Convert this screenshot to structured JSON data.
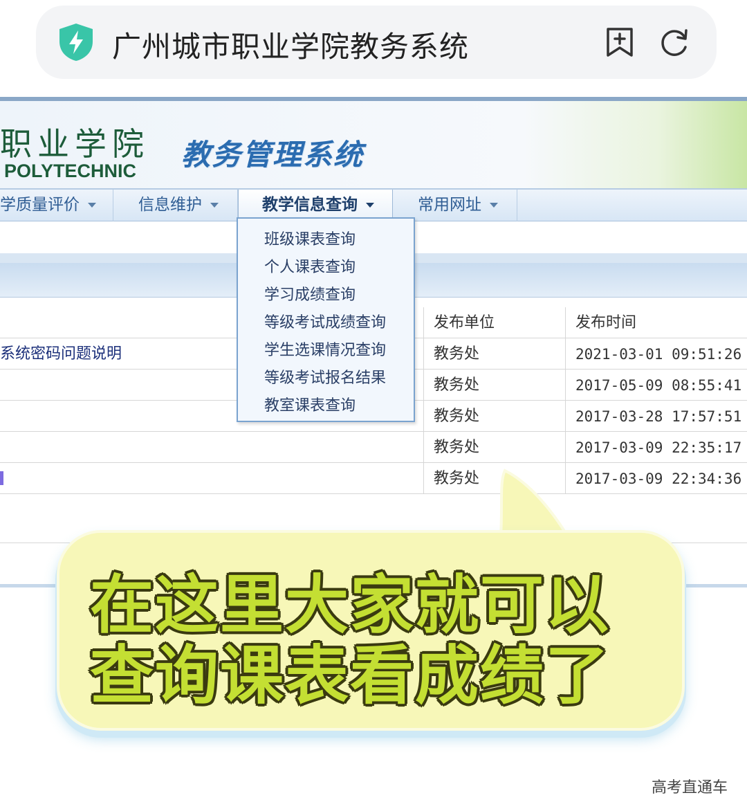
{
  "browser": {
    "site_title": "广州城市职业学院教务系统",
    "shield_color": "#39c5a8"
  },
  "header": {
    "school_cn": "职业学院",
    "school_en": "POLYTECHNIC",
    "system_title": "教务管理系统"
  },
  "nav": {
    "items": [
      {
        "label": "学质量评价"
      },
      {
        "label": "信息维护"
      },
      {
        "label": "教学信息查询"
      },
      {
        "label": "常用网址"
      }
    ]
  },
  "dropdown": {
    "items": [
      {
        "label": "班级课表查询"
      },
      {
        "label": "个人课表查询"
      },
      {
        "label": "学习成绩查询"
      },
      {
        "label": "等级考试成绩查询"
      },
      {
        "label": "学生选课情况查询"
      },
      {
        "label": "等级考试报名结果"
      },
      {
        "label": "教室课表查询"
      }
    ]
  },
  "table": {
    "headers": {
      "unit": "发布单位",
      "time": "发布时间"
    },
    "rows": [
      {
        "title": "系统密码问题说明",
        "unit": "教务处",
        "time": "2021-03-01 09:51:26"
      },
      {
        "title": "",
        "unit": "教务处",
        "time": "2017-05-09 08:55:41"
      },
      {
        "title": "",
        "unit": "教务处",
        "time": "2017-03-28 17:57:51"
      },
      {
        "title": "",
        "unit": "教务处",
        "time": "2017-03-09 22:35:17"
      },
      {
        "title": "",
        "unit": "教务处",
        "time": "2017-03-09 22:34:36"
      }
    ]
  },
  "callout": {
    "line1": "在这里大家就可以",
    "line2": "查询课表看成绩了"
  },
  "watermark": "高考直通车"
}
